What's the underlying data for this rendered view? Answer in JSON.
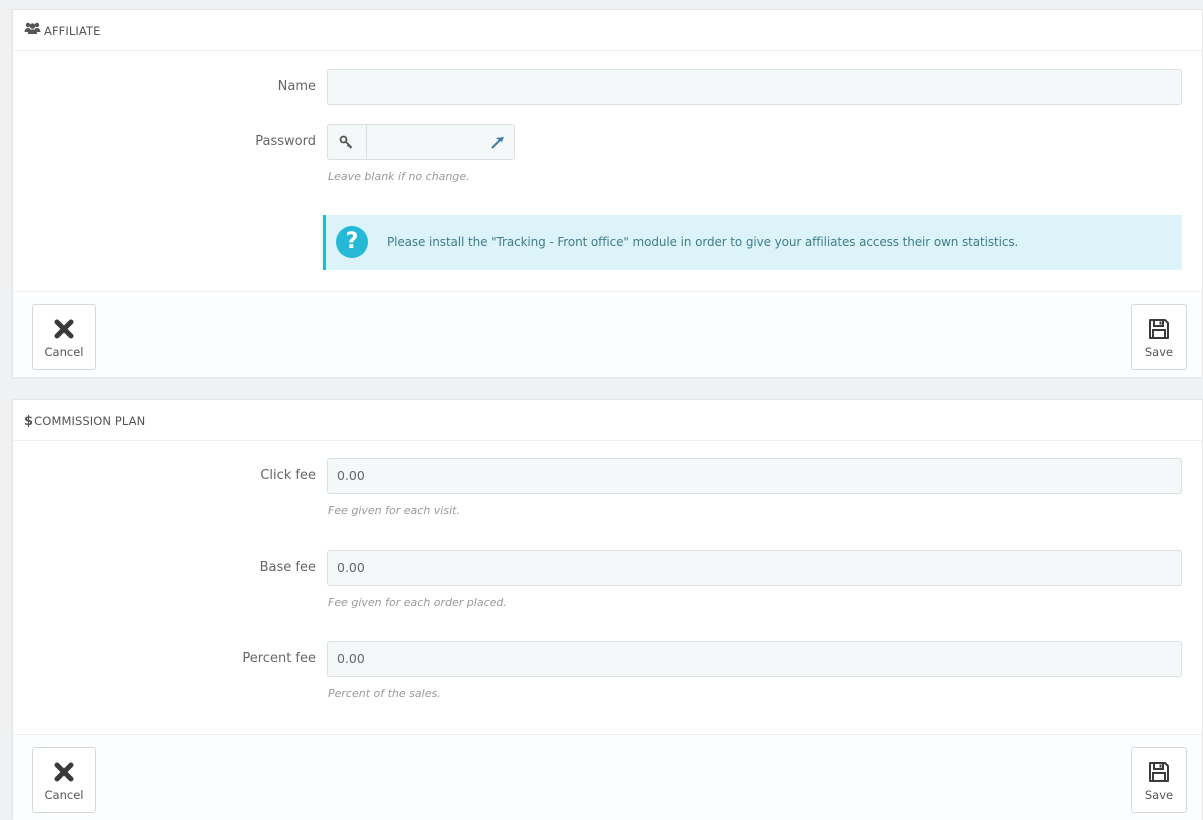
{
  "affiliate": {
    "heading": "AFFILIATE",
    "heading_icon": "users-icon",
    "name_label": "Name",
    "name_value": "",
    "password_label": "Password",
    "password_value": "",
    "password_help": "Leave blank if no change.",
    "info_icon": "question-circle-icon",
    "info_text": "Please install the \"Tracking - Front office\" module in order to give your affiliates access their own statistics.",
    "cancel_label": "Cancel",
    "save_label": "Save"
  },
  "commission": {
    "heading_symbol": "$",
    "heading": "COMMISSION PLAN",
    "click_fee_label": "Click fee",
    "click_fee_value": "0.00",
    "click_fee_help": "Fee given for each visit.",
    "base_fee_label": "Base fee",
    "base_fee_value": "0.00",
    "base_fee_help": "Fee given for each order placed.",
    "percent_fee_label": "Percent fee",
    "percent_fee_value": "0.00",
    "percent_fee_help": "Percent of the sales.",
    "cancel_label": "Cancel",
    "save_label": "Save"
  },
  "colors": {
    "accent": "#25b9d7",
    "info_bg": "#dcf4f9",
    "input_bg": "#f5f8f9",
    "page_bg": "#eff1f2"
  }
}
